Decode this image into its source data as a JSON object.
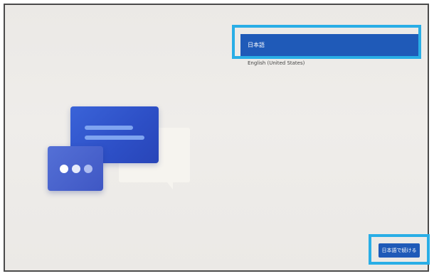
{
  "languages": {
    "items": [
      {
        "label": "日本語",
        "selected": true
      },
      {
        "label": "English (United States)",
        "selected": false
      }
    ]
  },
  "footer": {
    "continue_label": "日本語で続ける"
  },
  "colors": {
    "accent": "#1f5ab8",
    "highlight": "#29aee6",
    "background": "#ebe9e6"
  }
}
